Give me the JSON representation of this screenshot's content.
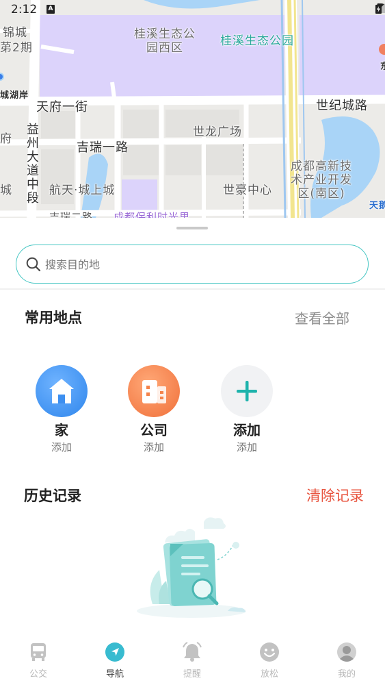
{
  "status_bar": {
    "time": "2:12",
    "notification": "A"
  },
  "map": {
    "labels": {
      "jincheng": "锦城",
      "phase2": "苐2期",
      "park_west": "桂溪生态公园西区",
      "park": "桂溪生态公园",
      "chenghuan": "城湖岸",
      "tianfu1": "天府一街",
      "shiji_road": "世纪城路",
      "fu": "府",
      "yizhou": "益州大道中段",
      "jirui1": "吉瑞一路",
      "shilong": "世龙广场",
      "hightech": "成都高新技术产业开发区(南区)",
      "cheng": "城",
      "hangtian": "航天·城上城",
      "shihao": "世豪中心",
      "tianfu_blue": "天鹅",
      "east": "东",
      "bottom_road": "吉瑞二路",
      "bottom_poi": "成都保利时光里"
    }
  },
  "search": {
    "placeholder": "搜索目的地"
  },
  "frequent": {
    "title": "常用地点",
    "view_all": "查看全部",
    "places": [
      {
        "name": "家",
        "sub": "添加",
        "icon": "home-icon"
      },
      {
        "name": "公司",
        "sub": "添加",
        "icon": "building-icon"
      },
      {
        "name": "添加",
        "sub": "添加",
        "icon": "plus-icon"
      }
    ]
  },
  "history": {
    "title": "历史记录",
    "clear": "清除记录"
  },
  "tabs": [
    {
      "label": "公交",
      "icon": "bus-icon",
      "active": false
    },
    {
      "label": "导航",
      "icon": "navigation-icon",
      "active": true
    },
    {
      "label": "提醒",
      "icon": "bell-icon",
      "active": false
    },
    {
      "label": "放松",
      "icon": "smile-icon",
      "active": false
    },
    {
      "label": "我的",
      "icon": "user-icon",
      "active": false
    }
  ],
  "colors": {
    "accent": "#45c6c3",
    "clear_red": "#e8543f",
    "park": "#dcd3fb",
    "water": "#a9d4f7"
  }
}
